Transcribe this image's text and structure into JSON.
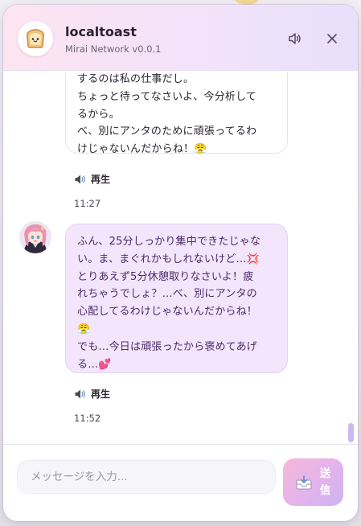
{
  "header": {
    "title": "localtoast",
    "subtitle": "Mirai Network v0.0.1",
    "avatar_icon": "toast-icon",
    "sound_icon": "speaker-icon",
    "close_icon": "close-icon"
  },
  "messages": [
    {
      "role": "assistant",
      "lines": [
        "するのは私の仕事だし。",
        "ちょっと待ってなさいよ、今分析して",
        "るから。",
        "べ、別にアンタのために頑張ってるわ",
        "けじゃないんだからね！😤"
      ],
      "play_label": "再生",
      "time": "11:27"
    },
    {
      "role": "assistant",
      "lines": [
        "ふん、25分しっかり集中できたじゃな",
        "い。ま、まぐれかもしれないけど…💢",
        "とりあえず5分休憩取りなさいよ！疲",
        "れちゃうでしょ？…べ、別にアンタの",
        "心配してるわけじゃないんだからね！",
        "😤",
        "でも…今日は頑張ったから褒めてあげ",
        "る…💕"
      ],
      "play_label": "再生",
      "time": "11:52"
    }
  ],
  "composer": {
    "placeholder": "メッセージを入力...",
    "send_label_top": "送",
    "send_label_bottom": "信",
    "send_icon": "inbox-tray-icon"
  },
  "colors": {
    "header_gradient": [
      "#fde4f1",
      "#e9e0fb"
    ],
    "assistant_bubble": "#f3e5fb",
    "assistant_text": "#4a2a6a",
    "send_gradient": [
      "#f6b7da",
      "#cdb4f0"
    ]
  }
}
